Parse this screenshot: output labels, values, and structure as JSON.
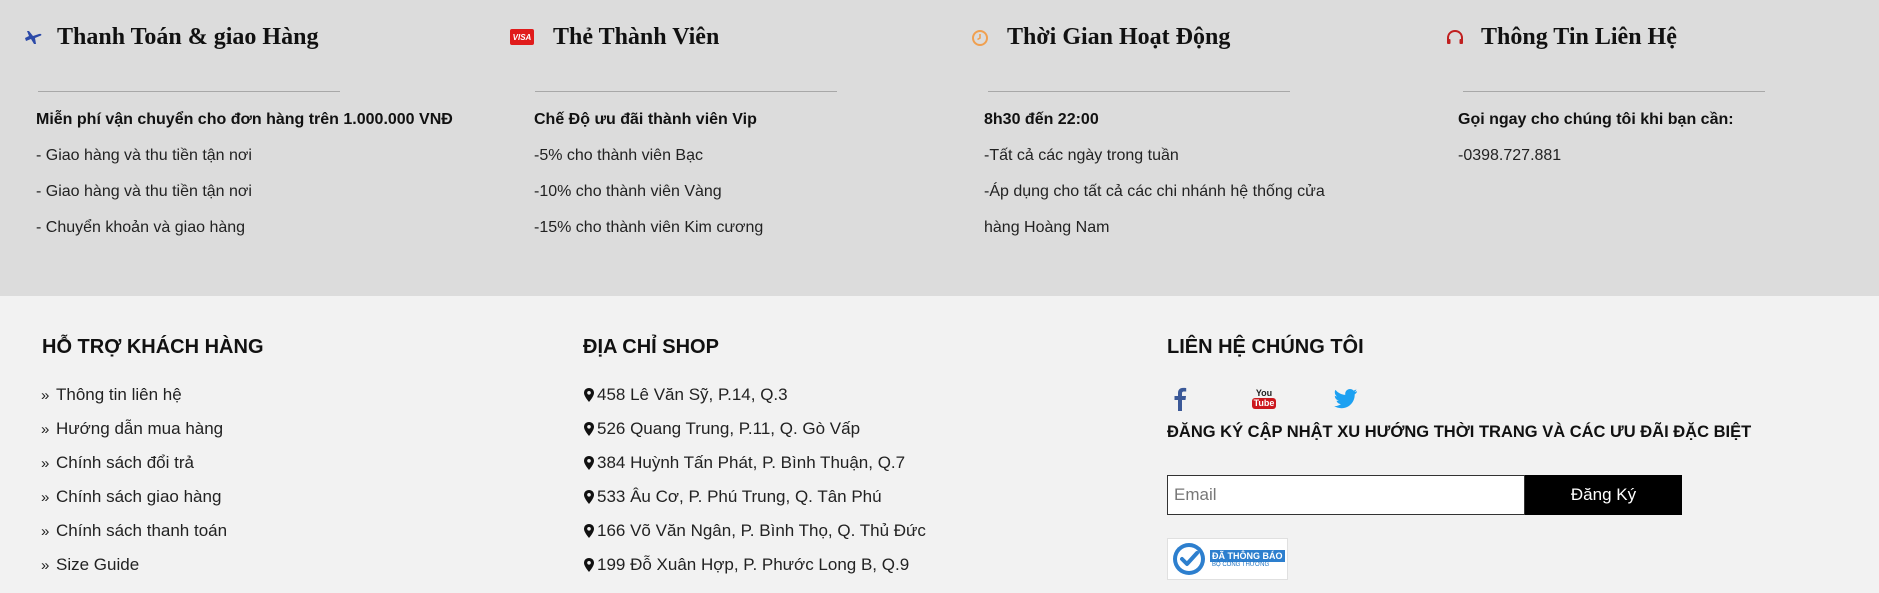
{
  "info_columns": [
    {
      "icon": "airplane-icon",
      "title": "Thanh Toán & giao Hàng",
      "lines": [
        "Miễn phí vận chuyển cho đơn hàng trên 1.000.000 VNĐ",
        "- Giao hàng và thu tiền tận nơi",
        "- Giao hàng và thu tiền tận nơi",
        "- Chuyển khoản và giao hàng"
      ]
    },
    {
      "icon": "visa-card-icon",
      "icon_text": "VISA",
      "title": "Thẻ Thành Viên",
      "lines": [
        "Chế Độ ưu đãi thành viên Vip",
        "-5% cho thành viên Bạc",
        "-10% cho thành viên Vàng",
        "-15% cho thành viên Kim cương"
      ]
    },
    {
      "icon": "clock-icon",
      "title": "Thời Gian Hoạt Động",
      "lines": [
        "8h30 đến 22:00",
        "-Tất cả các ngày trong tuần",
        "-Áp dụng cho tất cả các chi nhánh hệ thống cửa",
        "hàng Hoàng Nam"
      ]
    },
    {
      "icon": "headphones-icon",
      "title": "Thông Tin Liên Hệ",
      "lines": [
        "Gọi ngay cho chúng tôi khi bạn cần:",
        "-0398.727.881"
      ]
    }
  ],
  "support": {
    "heading": "HỖ TRỢ KHÁCH HÀNG",
    "links": [
      "Thông tin liên hệ",
      "Hướng dẫn mua hàng",
      "Chính sách đổi trả",
      "Chính sách giao hàng",
      "Chính sách thanh toán",
      "Size Guide"
    ]
  },
  "shops": {
    "heading": "ĐỊA CHỈ SHOP",
    "addresses": [
      "458 Lê Văn Sỹ, P.14, Q.3",
      "526 Quang Trung, P.11, Q. Gò Vấp",
      "384 Huỳnh Tấn Phát, P. Bình Thuận, Q.7",
      "533 Âu Cơ, P. Phú Trung, Q. Tân Phú",
      "166 Võ Văn Ngân, P. Bình Thọ, Q. Thủ Đức",
      "199 Đỗ Xuân Hợp, P. Phước Long B, Q.9"
    ]
  },
  "contact": {
    "heading": "LIÊN HỆ CHÚNG TÔI",
    "social": [
      {
        "icon": "facebook-icon"
      },
      {
        "icon": "youtube-icon",
        "line1": "You",
        "line2": "Tube"
      },
      {
        "icon": "twitter-icon"
      }
    ],
    "newsletter_text": "ĐĂNG KÝ CẬP NHẬT XU HƯỚNG THỜI TRANG VÀ CÁC ƯU ĐÃI ĐẶC BIỆT",
    "email_placeholder": "Email",
    "register_label": "Đăng Ký",
    "badge_line1": "ĐÃ THÔNG BÁO",
    "badge_line2": "BỘ CÔNG THƯƠNG"
  },
  "colors": {
    "top_bg": "#dcdcdc",
    "bottom_bg": "#f2f2f2",
    "airplane": "#2c4aa8",
    "visa": "#e01b1b",
    "clock": "#f0a050",
    "headphones": "#c02020",
    "facebook": "#3b5998",
    "youtube": "#cc181e",
    "twitter": "#1da1f2",
    "button_bg": "#000000"
  }
}
